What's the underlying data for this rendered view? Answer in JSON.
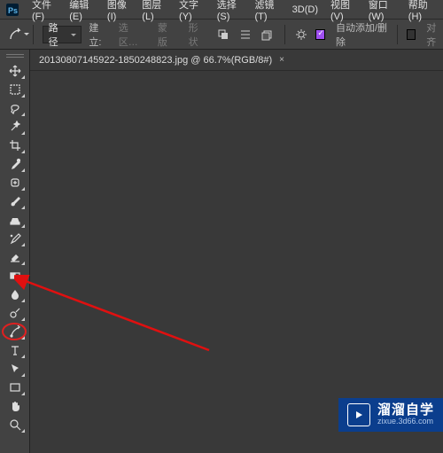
{
  "menu": {
    "items": [
      "文件(F)",
      "编辑(E)",
      "图像(I)",
      "图层(L)",
      "文字(Y)",
      "选择(S)",
      "滤镜(T)",
      "3D(D)",
      "视图(V)",
      "窗口(W)",
      "帮助(H)"
    ]
  },
  "options": {
    "mode_label": "路径",
    "build_label": "建立:",
    "btn_selection": "选区…",
    "btn_mask": "蒙版",
    "btn_shape": "形状",
    "auto_add_label": "自动添加/删除",
    "align_label": "对齐"
  },
  "tab": {
    "title": "20130807145922-1850248823.jpg @ 66.7%(RGB/8#)",
    "close": "×"
  },
  "watermark": {
    "main": "溜溜自学",
    "sub": "zixue.3d66.com"
  },
  "tools": [
    "move-tool",
    "marquee-tool",
    "lasso-tool",
    "magic-wand-tool",
    "crop-tool",
    "eyedropper-tool",
    "healing-brush-tool",
    "brush-tool",
    "clone-stamp-tool",
    "history-brush-tool",
    "eraser-tool",
    "gradient-tool",
    "blur-tool",
    "dodge-tool",
    "pen-tool",
    "type-tool",
    "path-selection-tool",
    "rectangle-tool",
    "hand-tool",
    "zoom-tool"
  ]
}
